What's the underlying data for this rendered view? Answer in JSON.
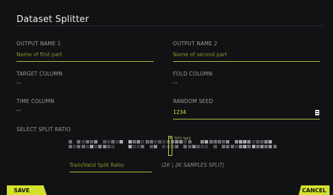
{
  "dialog": {
    "title": "Dataset Splitter",
    "output_name_1": {
      "label": "OUTPUT NAME 1",
      "placeholder": "Name of first part",
      "value": ""
    },
    "output_name_2": {
      "label": "OUTPUT NAME 2",
      "placeholder": "Name of second part",
      "value": ""
    },
    "target_column": {
      "label": "TARGET COLUMN",
      "value": "--"
    },
    "fold_column": {
      "label": "FOLD COLUMN",
      "value": "--"
    },
    "time_column": {
      "label": "TIME COLUMN",
      "value": "--"
    },
    "random_seed": {
      "label": "RANDOM SEED",
      "value": "1234"
    },
    "split_ratio": {
      "label": "SELECT SPLIT RATIO",
      "marker_label": "50% Split",
      "field_placeholder": "Train/Valid Split Ratio",
      "samples_text": "(2K | 2K SAMPLES SPLIT)",
      "split_fraction": 0.5
    },
    "buttons": {
      "save": "SAVE",
      "cancel": "CANCEL"
    },
    "colors": {
      "accent": "#d6e12e",
      "panel": "#111214",
      "text": "#9b9b9b"
    }
  }
}
